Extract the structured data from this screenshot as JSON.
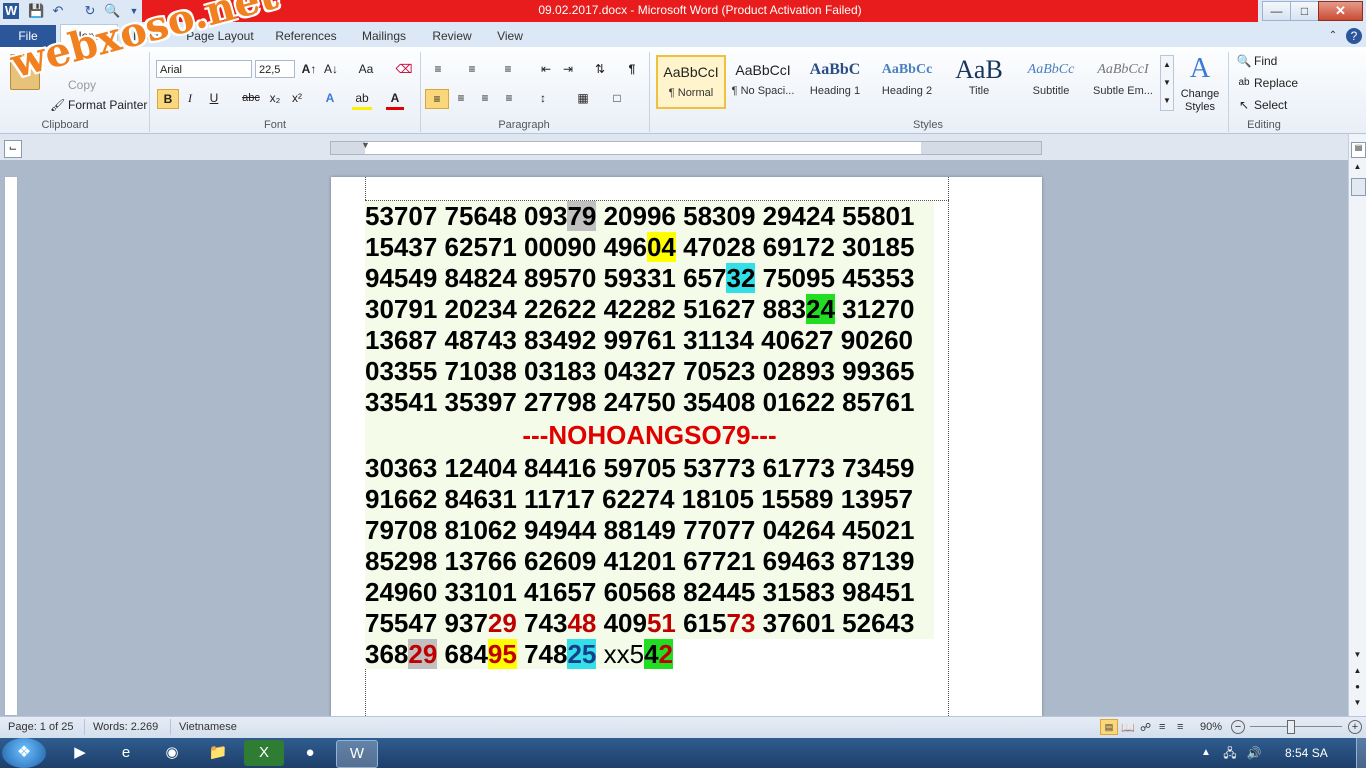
{
  "window": {
    "title": "09.02.2017.docx - Microsoft Word (Product Activation Failed)",
    "minimize": "—",
    "maximize": "□",
    "close": "✕"
  },
  "watermark": "webxoso.net",
  "tabs": {
    "file": "File",
    "home": "Home",
    "insert": "Insert",
    "page_layout": "Page Layout",
    "references": "References",
    "mailings": "Mailings",
    "review": "Review",
    "view": "View"
  },
  "clipboard": {
    "copy": "Copy",
    "format_painter": "Format Painter",
    "label": "Clipboard"
  },
  "font": {
    "name": "Arial",
    "size": "22,5",
    "label": "Font"
  },
  "paragraph": {
    "label": "Paragraph"
  },
  "styles": {
    "label": "Styles",
    "items": [
      {
        "preview": "AaBbCcI",
        "name": "¶ Normal"
      },
      {
        "preview": "AaBbCcI",
        "name": "¶ No Spaci..."
      },
      {
        "preview": "AaBbC",
        "name": "Heading 1"
      },
      {
        "preview": "AaBbCc",
        "name": "Heading 2"
      },
      {
        "preview": "AaB",
        "name": "Title"
      },
      {
        "preview": "AaBbCc",
        "name": "Subtitle"
      },
      {
        "preview": "AaBbCcI",
        "name": "Subtle Em..."
      }
    ],
    "change_styles": "Change Styles"
  },
  "editing": {
    "label": "Editing",
    "find": "Find",
    "replace": "Replace",
    "select": "Select"
  },
  "document": {
    "block1": [
      [
        "53707 75648 093",
        "79",
        " 20996 58309 29424 55801"
      ],
      [
        "15437 62571 00090 496",
        "04",
        " 47028 69172 30185"
      ],
      [
        "94549 84824 89570 59331 657",
        "32",
        " 75095 45353"
      ],
      [
        "30791 20234 22622 42282 51627 883",
        "24",
        " 31270"
      ],
      [
        "13687 48743 83492 99761 31134 40627 90260"
      ],
      [
        "03355 71038 03183 04327 70523 02893 99365"
      ],
      [
        "33541 35397 27798 24750 35408 01622 85761"
      ]
    ],
    "banner": "---NOHOANGSO79---",
    "block2": [
      "30363 12404 84416 59705 53773 61773 73459",
      "91662 84631 11717 62274 18105 15589 13957",
      "79708 81062 94944 88149 77077 04264 45021",
      "85298 13766 62609 41201 67721 69463 87139",
      "24960 33101 41657 60568 82445 31583 98451"
    ],
    "line_red": {
      "a": "75547 937",
      "a_red": "29",
      "b": " 743",
      "b_red": "48",
      "c": " 409",
      "c_red": "51",
      "d": " 615",
      "d_red": "73",
      "e": " 37601 52643"
    },
    "line_last": {
      "a": "368",
      "a_hl": "29",
      "b": " 684",
      "b_hl": "95",
      "c": " 748",
      "c_hl": "25",
      "d": " xx5",
      "d_hl1": "4",
      "d_hl2": "2"
    }
  },
  "status": {
    "page": "Page: 1 of 25",
    "words": "Words: 2.269",
    "language": "Vietnamese",
    "zoom": "90%"
  },
  "taskbar": {
    "clock": "8:54 SA"
  }
}
